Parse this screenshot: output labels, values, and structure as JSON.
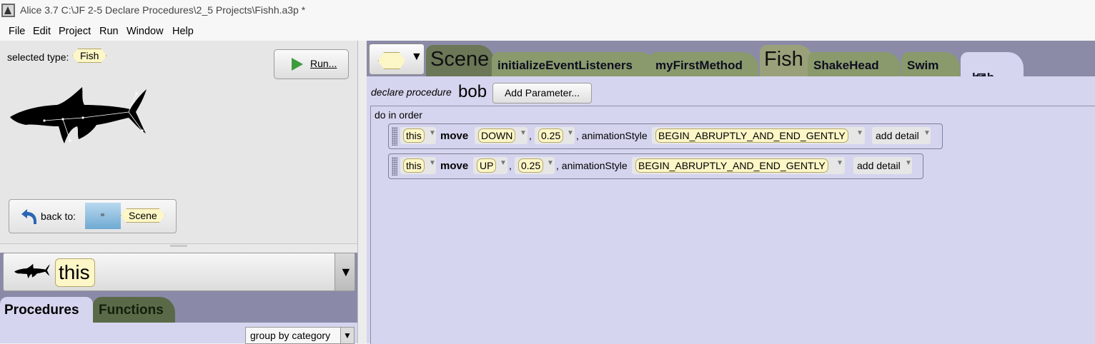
{
  "window": {
    "title": "Alice 3.7 C:\\JF 2-5 Declare Procedures\\2_5 Projects\\Fishh.a3p *"
  },
  "menu": [
    "File",
    "Edit",
    "Project",
    "Run",
    "Window",
    "Help"
  ],
  "left": {
    "selected_type_label": "selected type:",
    "selected_type": "Fish",
    "run_label": "Run...",
    "back_label": "back to:",
    "back_target": "Scene",
    "instance": "this",
    "tabs": {
      "procedures": "Procedures",
      "functions": "Functions"
    },
    "group_by": "group by category"
  },
  "editor": {
    "tabs": {
      "scene": "Scene",
      "initialize": "initializeEventListeners",
      "my_first": "myFirstMethod",
      "fish": "Fish",
      "shake": "ShakeHead",
      "swim": "Swim",
      "bob": "bob"
    },
    "declare_label": "declare procedure",
    "procedure_name": "bob",
    "add_parameter": "Add Parameter...",
    "do_in_order": "do in order",
    "statements": [
      {
        "target": "this",
        "method": "move",
        "direction": "DOWN",
        "amount": "0.25",
        "sep": ",",
        "style_label": ", animationStyle",
        "style": "BEGIN_ABRUPTLY_AND_END_GENTLY",
        "detail": "add detail"
      },
      {
        "target": "this",
        "method": "move",
        "direction": "UP",
        "amount": "0.25",
        "sep": ",",
        "style_label": ", animationStyle",
        "style": "BEGIN_ABRUPTLY_AND_END_GENTLY",
        "detail": "add detail"
      }
    ]
  },
  "colors": {
    "tile_yellow": "#fdf6c6",
    "editor_bg": "#d5d5ef",
    "panel_bg": "#8b8ba8",
    "run_green": "#3d9b3d"
  },
  "icons": [
    "app-icon",
    "run-icon",
    "back-arrow-icon",
    "shark-icon",
    "dropdown-icon",
    "close-icon"
  ]
}
